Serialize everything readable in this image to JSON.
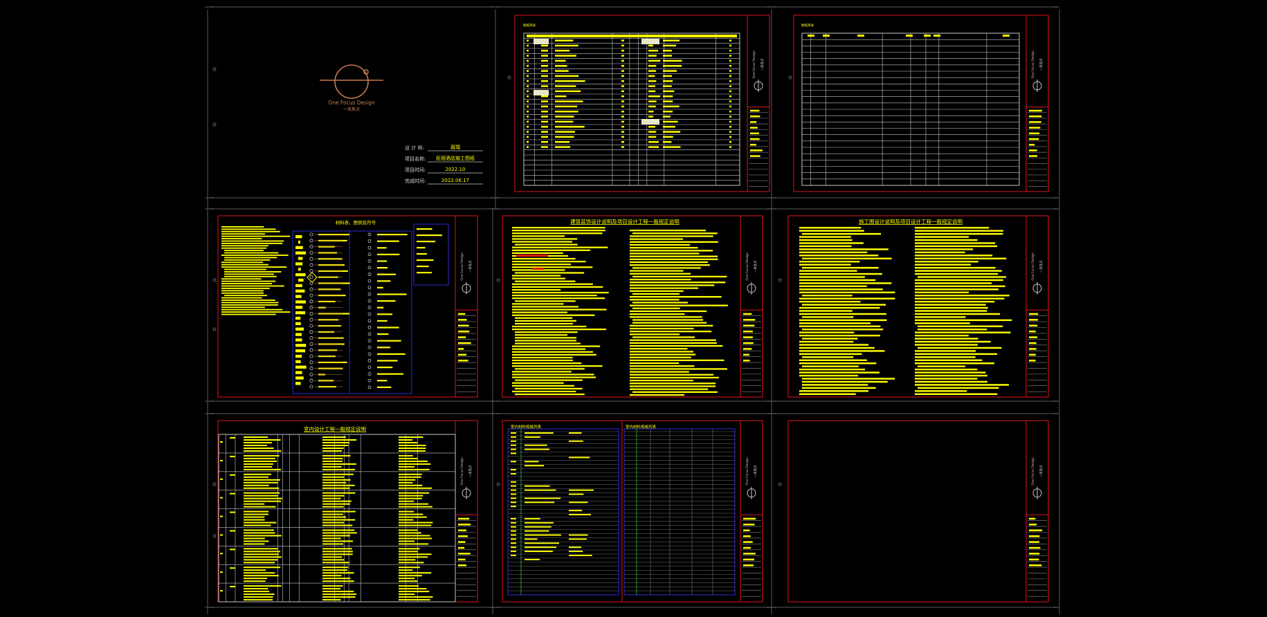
{
  "cover": {
    "logo_name": "One Focus Design",
    "logo_cn": "一束焦点",
    "rows": [
      {
        "label": "设 计 师:",
        "value": "聂瑞"
      },
      {
        "label": "项目名称:",
        "value": "民宿酒店施工图纸"
      },
      {
        "label": "项目时间:",
        "value": "2022.10"
      },
      {
        "label": "完成时间:",
        "value": "2022.06.17"
      }
    ]
  },
  "sheets": {
    "s2_title": "图纸目录",
    "s4_title": "材料表、图例及符号",
    "s5_title": "建筑装饰设计说明及项目设计工程一般规定说明",
    "s6_title": "施工图设计说明及项目设计工程一般规定说明",
    "s7_title": "室内设计工程一般规定说明",
    "s8_title_a": "室内材料规格列表",
    "s8_title_b": "室内材料规格列表"
  },
  "titleblock": {
    "brand": "One Focus Design",
    "brand_cn": "一束焦点"
  },
  "colors": {
    "frame": "#e0151b",
    "ink": "#ffff00",
    "blue": "#2b2bd8",
    "grid": "#a5a5a5",
    "cad_line": "#c8c8c8",
    "logo": "#c97a50",
    "green": "#1fcf3a"
  }
}
